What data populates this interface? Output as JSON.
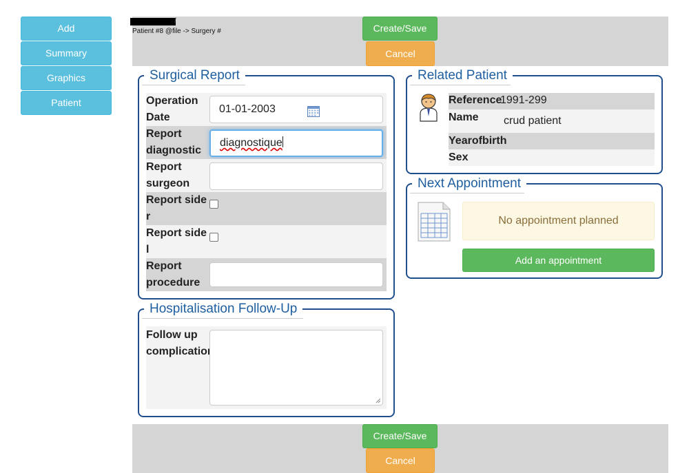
{
  "nav": {
    "items": [
      "Add",
      "Summary",
      "Graphics",
      "Patient"
    ]
  },
  "topbar": {
    "breadcrumb_slash": "/",
    "breadcrumb": "Patient #8 @file -> Surgery #",
    "save_label": "Create/Save",
    "cancel_label": "Cancel"
  },
  "surgical_report": {
    "legend": "Surgical Report",
    "fields": [
      {
        "label": "Operation Date",
        "value": "01-01-2003"
      },
      {
        "label": "Report diagnostic",
        "value": "diagnostique"
      },
      {
        "label": "Report surgeon",
        "value": ""
      },
      {
        "label": "Report side r",
        "checked": false
      },
      {
        "label": "Report side l",
        "checked": false
      },
      {
        "label": "Report procedure",
        "value": ""
      }
    ]
  },
  "hospitalisation": {
    "legend": "Hospitalisation Follow-Up",
    "fields": [
      {
        "label": "Follow up complication",
        "value": ""
      }
    ]
  },
  "related_patient": {
    "legend": "Related Patient",
    "icon": "patient-avatar-icon",
    "rows": [
      {
        "key": "Reference",
        "value": "1991-299"
      },
      {
        "key": "Name",
        "value": "crud patient"
      },
      {
        "key": "Yearofbirth",
        "value": ""
      },
      {
        "key": "Sex",
        "value": ""
      }
    ]
  },
  "next_appointment": {
    "legend": "Next Appointment",
    "icon": "calendar-sheet-icon",
    "notice": "No appointment planned",
    "add_label": "Add an appointment"
  },
  "bottombar": {
    "save_label": "Create/Save",
    "cancel_label": "Cancel"
  },
  "colors": {
    "info": "#5bc0de",
    "success": "#5cb85c",
    "warning": "#f0ad4e",
    "legend": "#1f5fa0",
    "border": "#1f4e8c"
  }
}
